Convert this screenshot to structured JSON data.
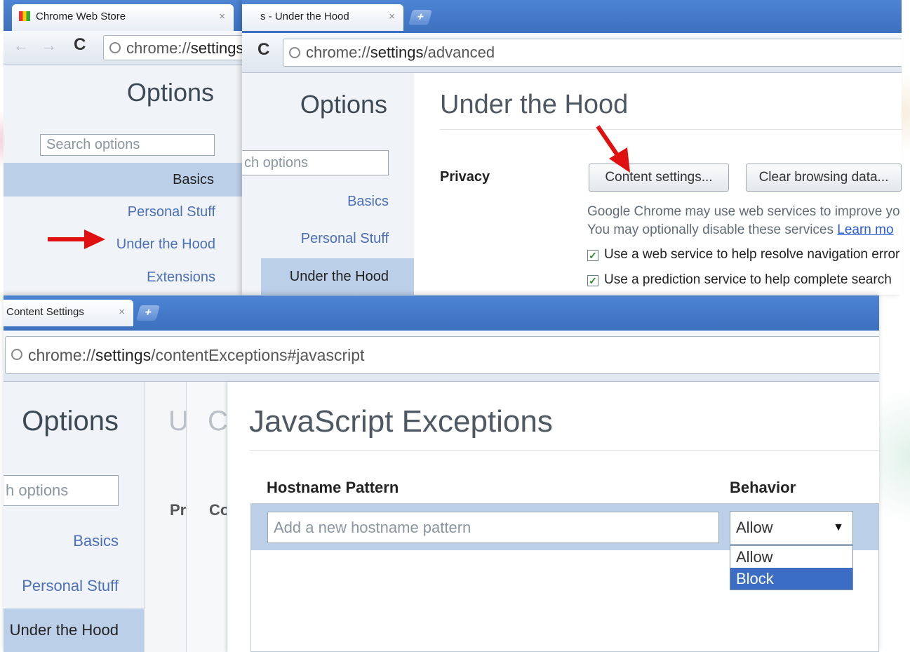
{
  "screen1": {
    "tab_title": "Chrome Web Store",
    "tab_close": "×",
    "nav_back": "←",
    "nav_forward": "→",
    "nav_reload": "C",
    "url_scheme": "chrome://",
    "url_host": "settings",
    "options_title": "Options",
    "search_placeholder": "Search options",
    "nav_items": [
      "Basics",
      "Personal Stuff",
      "Under the Hood",
      "Extensions"
    ]
  },
  "screen2": {
    "tab_title": "s - Under the Hood",
    "tab_close": "×",
    "new_tab": "+",
    "url_scheme": "chrome://",
    "url_host": "settings",
    "url_path": "/advanced",
    "options_title": "Options",
    "search_text": "ch options",
    "nav_items": [
      "Basics",
      "Personal Stuff",
      "Under the Hood"
    ],
    "page_title": "Under the Hood",
    "section_label": "Privacy",
    "content_settings_btn": "Content settings...",
    "clear_data_btn": "Clear browsing data...",
    "desc_line1": "Google Chrome may use web services to improve yo",
    "desc_line2": "You may optionally disable these services ",
    "learn_more": "Learn mo",
    "check1": "Use a web service to help resolve navigation error",
    "check2": "Use a prediction service to help complete search"
  },
  "screen3": {
    "tab_title": "Content Settings",
    "tab_close": "×",
    "new_tab": "+",
    "url_scheme": "chrome://",
    "url_host": "settings",
    "url_path": "/contentExceptions#javascript",
    "options_title": "Options",
    "search_text": "h options",
    "nav_items": [
      "Basics",
      "Personal Stuff",
      "Under the Hood"
    ],
    "overlay1_letter": "U",
    "overlay1_sub": "Pr",
    "overlay2_letter": "C",
    "overlay2_sub": "Co",
    "dialog_title": "JavaScript Exceptions",
    "col_hostname": "Hostname Pattern",
    "col_behavior": "Behavior",
    "hostname_placeholder": "Add a new hostname pattern",
    "behavior_value": "Allow",
    "behavior_options": [
      "Allow",
      "Block"
    ]
  }
}
